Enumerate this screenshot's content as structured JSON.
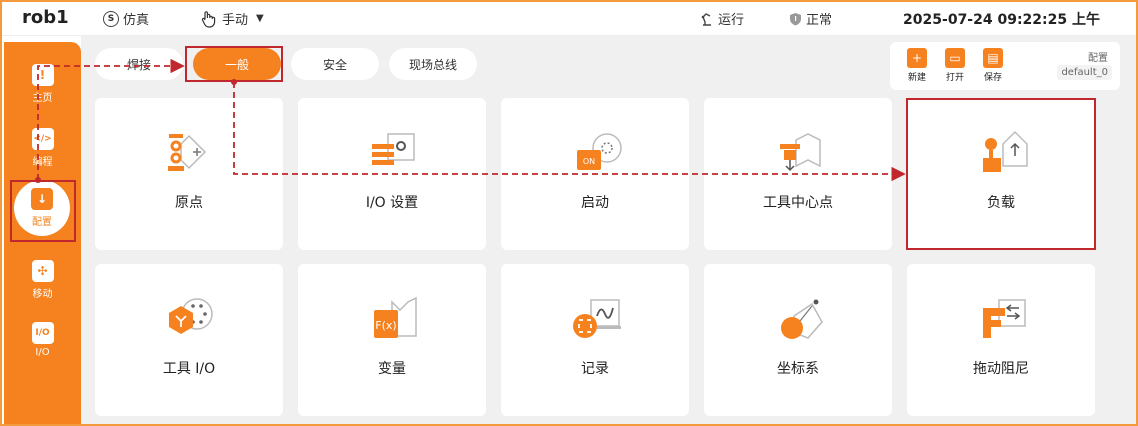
{
  "topbar": {
    "robot_name": "rob1",
    "sim_label": "仿真",
    "sim_icon_letter": "S",
    "mode_label": "手动",
    "mode_caret": "▼",
    "run_label": "运行",
    "state_label": "正常",
    "datetime": "2025-07-24 09:22:25 上午"
  },
  "sidebar": {
    "items": [
      {
        "label": "主页",
        "icon": "home-icon",
        "glyph": "!"
      },
      {
        "label": "编程",
        "icon": "code-icon",
        "glyph": "</>"
      },
      {
        "label": "配置",
        "icon": "config-icon",
        "glyph": "↓"
      },
      {
        "label": "移动",
        "icon": "move-icon",
        "glyph": "✣"
      },
      {
        "label": "I/O",
        "icon": "io-icon",
        "glyph": "I/O"
      }
    ]
  },
  "tabs": [
    {
      "label": "焊接"
    },
    {
      "label": "一般"
    },
    {
      "label": "安全"
    },
    {
      "label": "现场总线"
    }
  ],
  "config_panel": {
    "new_label": "新建",
    "open_label": "打开",
    "save_label": "保存",
    "title": "配置",
    "value": "default_0"
  },
  "cards": [
    {
      "label": "原点",
      "icon": "origin-icon"
    },
    {
      "label": "I/O 设置",
      "icon": "io-settings-icon"
    },
    {
      "label": "启动",
      "icon": "startup-icon"
    },
    {
      "label": "工具中心点",
      "icon": "tcp-icon"
    },
    {
      "label": "负载",
      "icon": "payload-icon"
    },
    {
      "label": "工具 I/O",
      "icon": "tool-io-icon"
    },
    {
      "label": "变量",
      "icon": "variables-icon"
    },
    {
      "label": "记录",
      "icon": "log-icon"
    },
    {
      "label": "坐标系",
      "icon": "frames-icon"
    },
    {
      "label": "拖动阻尼",
      "icon": "drag-damping-icon"
    }
  ],
  "colors": {
    "accent": "#f5821f",
    "highlight": "#c0282d",
    "background": "#f0f0f0"
  }
}
